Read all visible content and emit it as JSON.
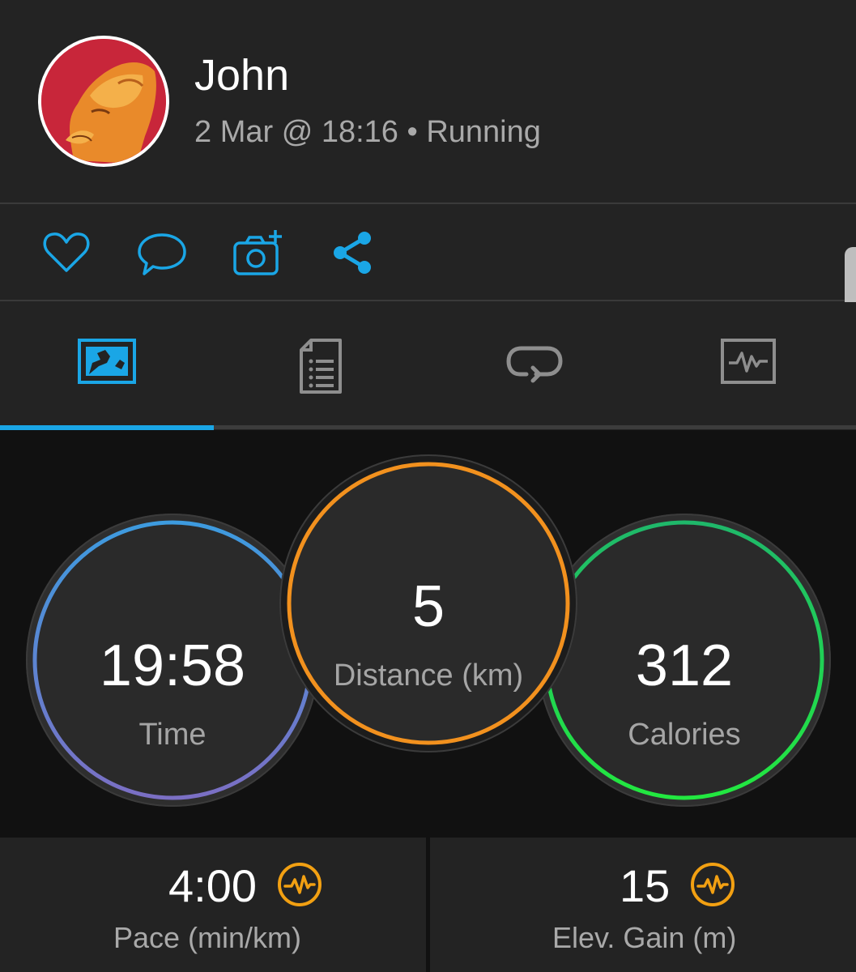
{
  "activity": {
    "user_name": "John",
    "subtitle": "2 Mar @ 18:16 • Running"
  },
  "actions": {
    "icons": [
      "heart-icon",
      "comment-icon",
      "add-photo-icon",
      "share-icon"
    ],
    "accent_color": "#1aa6e6"
  },
  "tabs": {
    "items": [
      "overview-tab",
      "details-tab",
      "laps-tab",
      "charts-tab"
    ],
    "selected": "overview-tab"
  },
  "stats": {
    "time": {
      "value": "19:58",
      "label": "Time"
    },
    "distance": {
      "value": "5",
      "label": "Distance (km)"
    },
    "calories": {
      "value": "312",
      "label": "Calories"
    }
  },
  "metrics": {
    "pace": {
      "value": "4:00",
      "label": "Pace (min/km)"
    },
    "elevation": {
      "value": "15",
      "label": "Elev. Gain (m)"
    }
  },
  "colors": {
    "time_ring": [
      "#3d9bdf",
      "#7b6fc4"
    ],
    "distance_ring": "#f2911e",
    "calories_ring": [
      "#1fb86a",
      "#22e840"
    ],
    "pulse_icon": "#f2a012"
  }
}
